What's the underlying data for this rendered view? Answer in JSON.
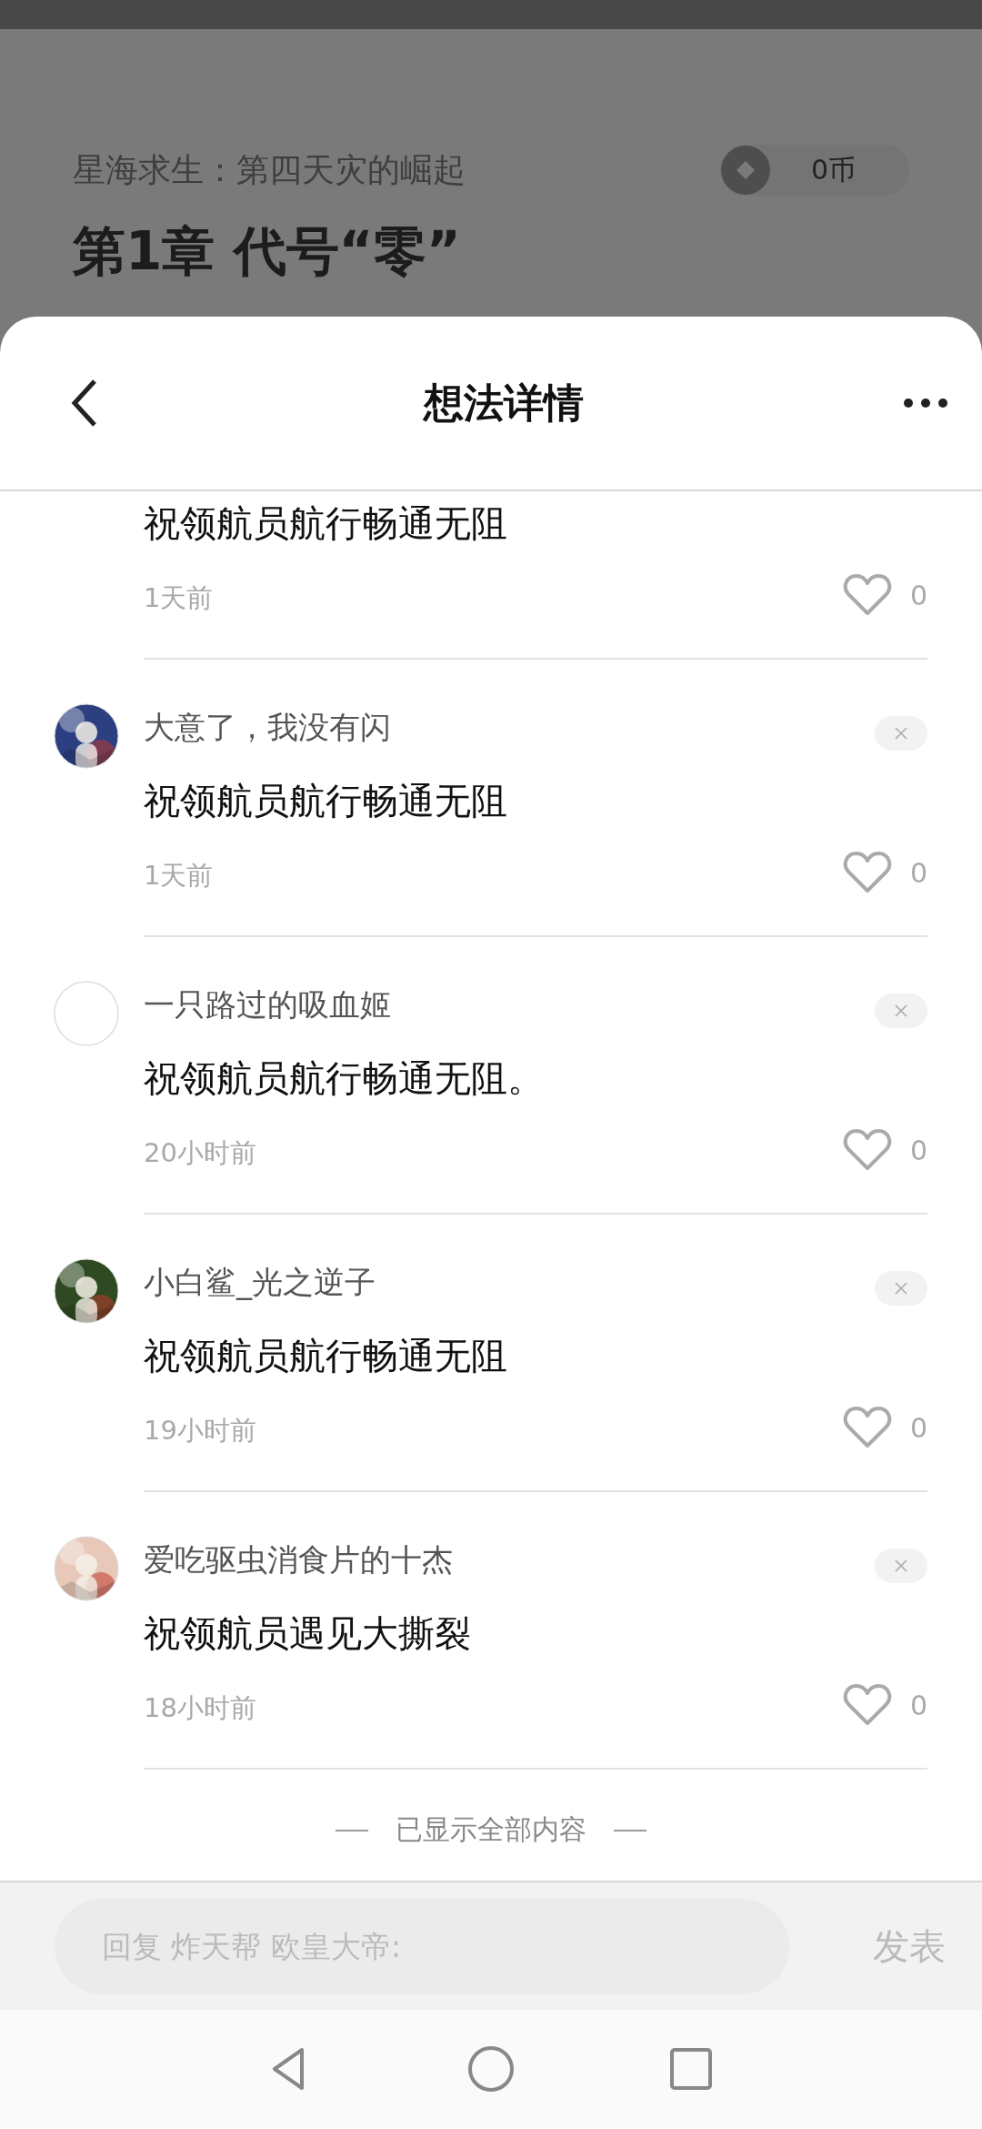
{
  "background": {
    "book_title": "星海求生：第四天灾的崛起",
    "coins": "0币",
    "chapter_title": "第1章 代号“零”"
  },
  "header": {
    "title": "想法详情"
  },
  "comments": [
    {
      "content": "祝领航员航行畅通无阻",
      "time": "1天前",
      "likes": "0"
    },
    {
      "name": "大意了，我没有闪",
      "content": "祝领航员航行畅通无阻",
      "time": "1天前",
      "likes": "0"
    },
    {
      "avatar": {
        "kind": "empty"
      },
      "name": "一只路过的吸血姬",
      "content": "祝领航员航行畅通无阻。",
      "time": "20小时前",
      "likes": "0"
    },
    {
      "name": "小白鲨_光之逆子",
      "content": "祝领航员航行畅通无阻",
      "time": "19小时前",
      "likes": "0"
    },
    {
      "name": "爱吃驱虫消食片的十杰",
      "content": "祝领航员遇见大撕裂",
      "time": "18小时前",
      "likes": "0"
    }
  ],
  "end_note": "已显示全部内容",
  "reply_bar": {
    "placeholder": "回复 炸天帮 欧皇大帝:",
    "send": "发表"
  }
}
